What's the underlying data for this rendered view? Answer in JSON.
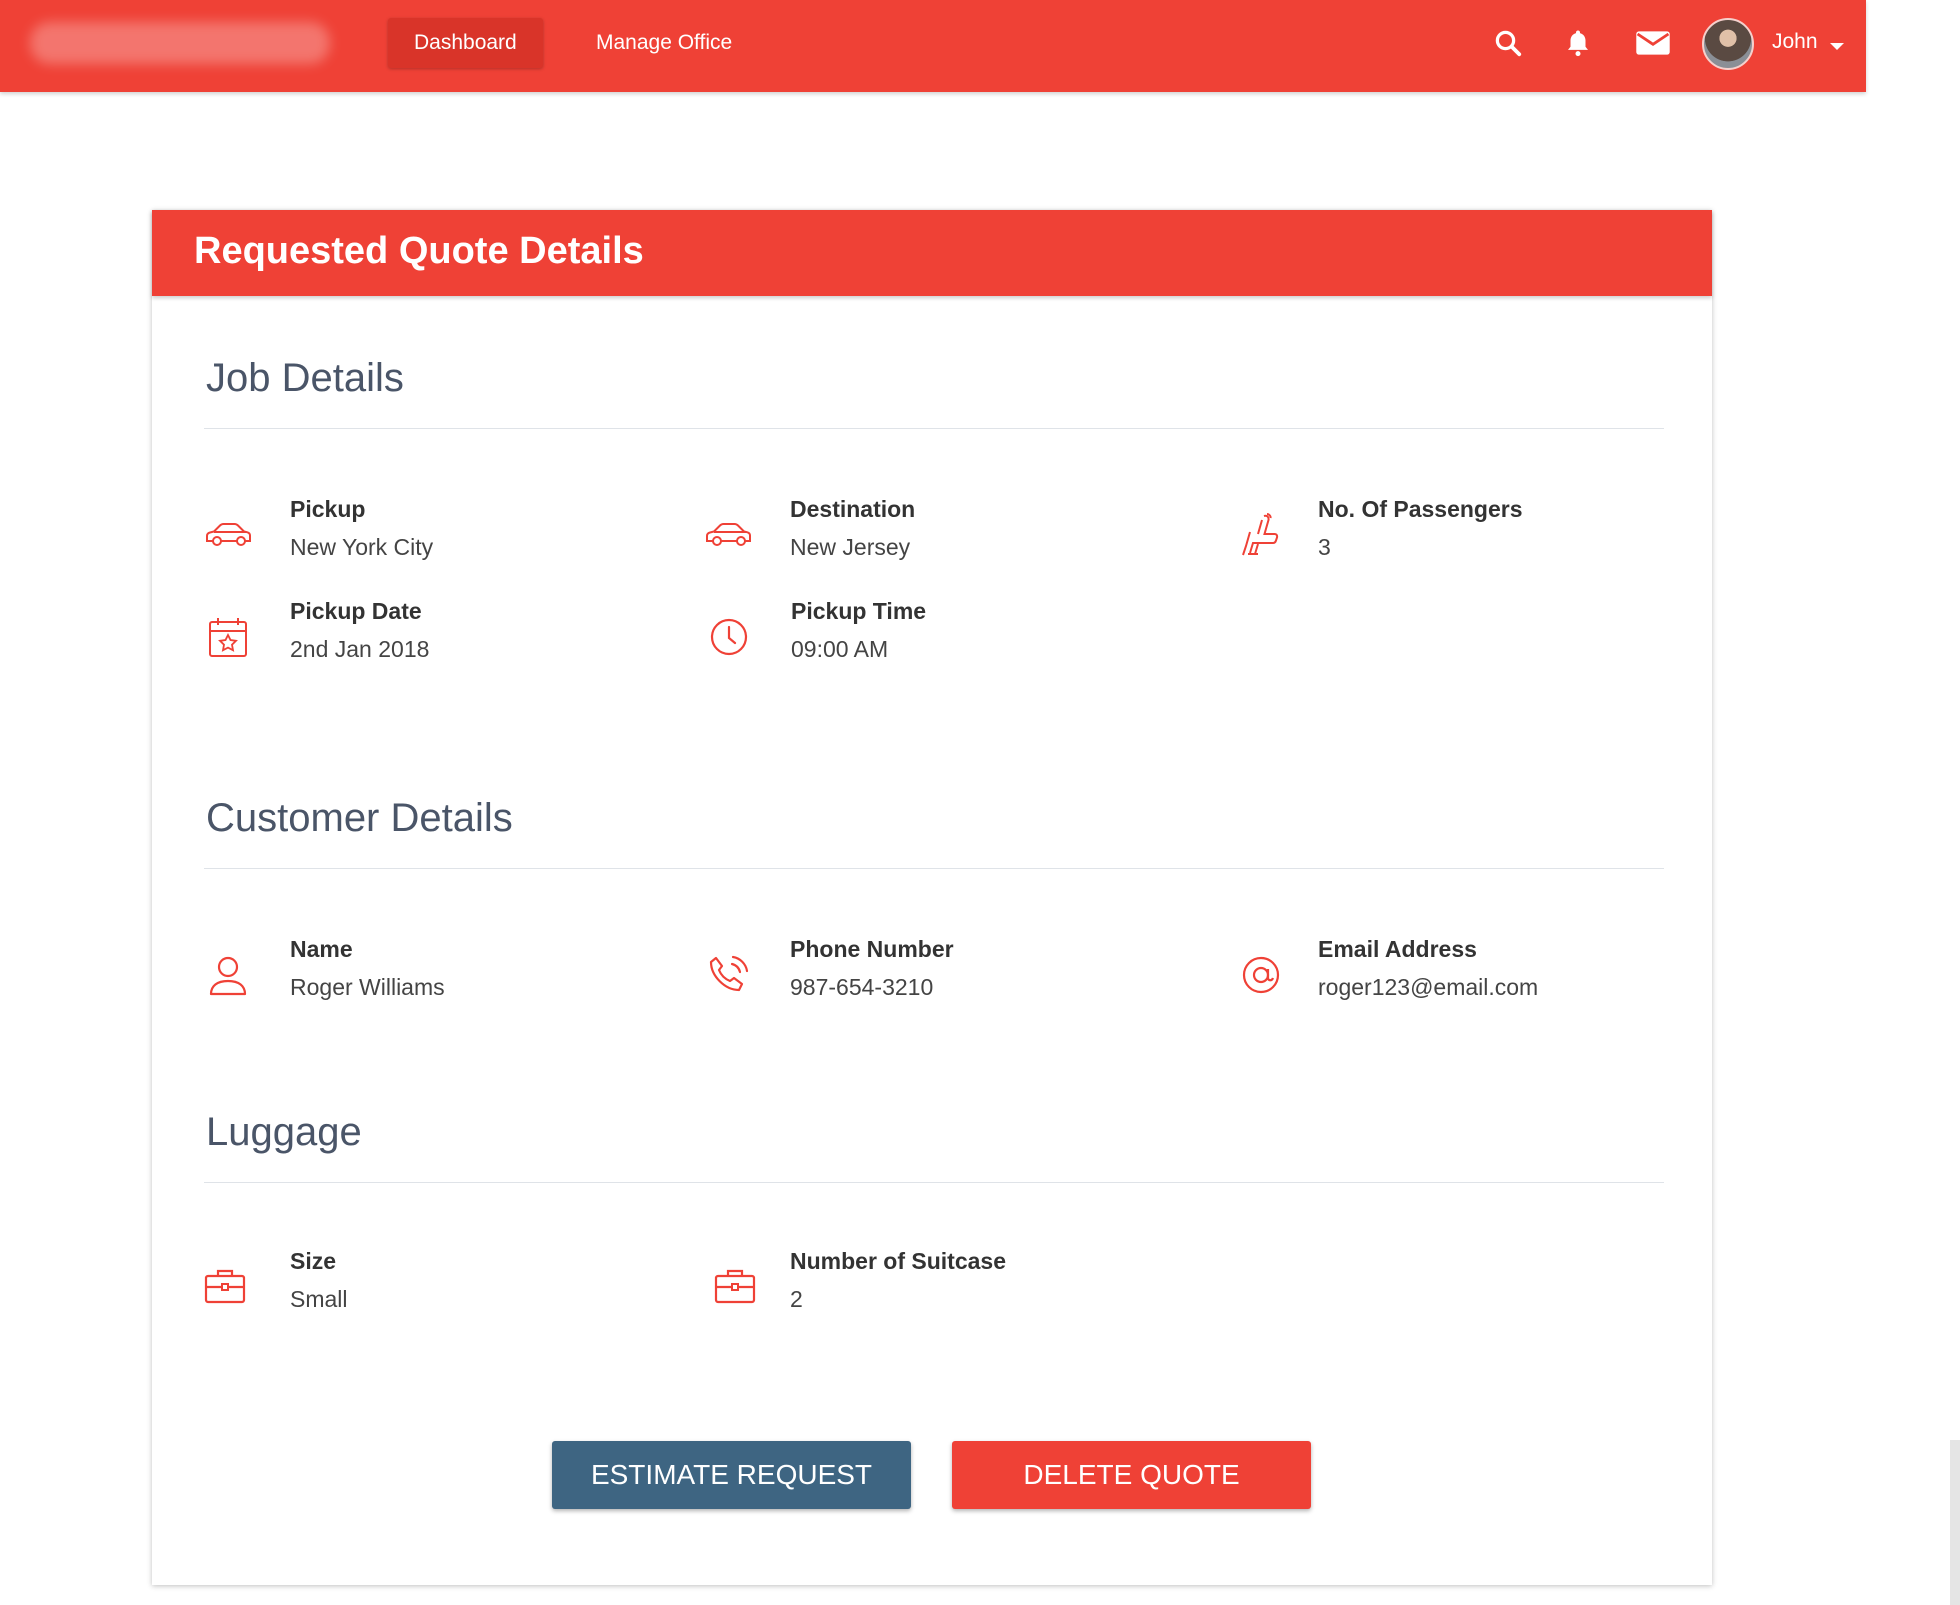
{
  "nav": {
    "dashboard": "Dashboard",
    "manage_office": "Manage Office",
    "user_name": "John"
  },
  "card": {
    "title": "Requested Quote Details"
  },
  "job": {
    "title": "Job Details",
    "pickup_label": "Pickup",
    "pickup_value": "New York City",
    "destination_label": "Destination",
    "destination_value": "New Jersey",
    "passengers_label": "No. Of Passengers",
    "passengers_value": "3",
    "date_label": "Pickup Date",
    "date_value": "2nd Jan 2018",
    "time_label": "Pickup Time",
    "time_value": "09:00 AM"
  },
  "customer": {
    "title": "Customer Details",
    "name_label": "Name",
    "name_value": "Roger Williams",
    "phone_label": "Phone Number",
    "phone_value": "987-654-3210",
    "email_label": "Email Address",
    "email_value": "roger123@email.com"
  },
  "luggage": {
    "title": "Luggage",
    "size_label": "Size",
    "size_value": "Small",
    "count_label": "Number of Suitcase",
    "count_value": "2"
  },
  "actions": {
    "estimate": "ESTIMATE REQUEST",
    "delete": "DELETE QUOTE"
  },
  "theme": {
    "primary": "#ef4136",
    "secondary": "#3e6582"
  },
  "icons": [
    "search-icon",
    "bell-icon",
    "mail-icon",
    "car-icon",
    "seat-icon",
    "calendar-icon",
    "clock-icon",
    "user-icon",
    "phone-icon",
    "at-icon",
    "briefcase-icon"
  ]
}
